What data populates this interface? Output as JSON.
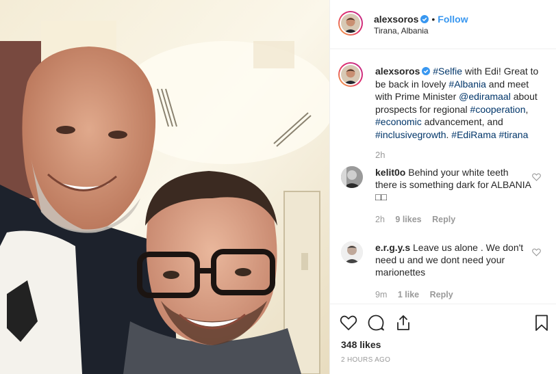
{
  "post": {
    "username": "alexsoros",
    "follow_label": "Follow",
    "location": "Tirana, Albania",
    "caption": {
      "author": "alexsoros",
      "segments": [
        {
          "text": "#Selfie",
          "tag": true
        },
        {
          "text": " with Edi! Great to be back in lovely ",
          "tag": false
        },
        {
          "text": "#Albania",
          "tag": true
        },
        {
          "text": " and meet with Prime Minister ",
          "tag": false
        },
        {
          "text": "@ediramaal",
          "tag": true
        },
        {
          "text": " about prospects for regional ",
          "tag": false
        },
        {
          "text": "#cooperation",
          "tag": true
        },
        {
          "text": ", ",
          "tag": false
        },
        {
          "text": "#economic",
          "tag": true
        },
        {
          "text": " advancement, and ",
          "tag": false
        },
        {
          "text": "#inclusivegrowth",
          "tag": true
        },
        {
          "text": ". ",
          "tag": false
        },
        {
          "text": "#EdiRama",
          "tag": true
        },
        {
          "text": " ",
          "tag": false
        },
        {
          "text": "#tirana",
          "tag": true
        }
      ],
      "time": "2h"
    },
    "comments": [
      {
        "user": "kelit0o",
        "text": " Behind your white teeth there is something dark for ALBANIA □□",
        "time": "2h",
        "likes": "9 likes",
        "reply": "Reply"
      },
      {
        "user": "e.r.g.y.s",
        "text": " Leave us alone . We don't need u and we dont need your marionettes",
        "time": "9m",
        "likes": "1 like",
        "reply": "Reply"
      }
    ],
    "likes": "348 likes",
    "posted_ago": "2 HOURS AGO"
  },
  "colors": {
    "link": "#003569",
    "follow": "#3897f0",
    "verified": "#3897f0",
    "muted": "#999999"
  },
  "icons": [
    "verified-icon",
    "heart-icon",
    "comment-icon",
    "share-icon",
    "bookmark-icon"
  ]
}
